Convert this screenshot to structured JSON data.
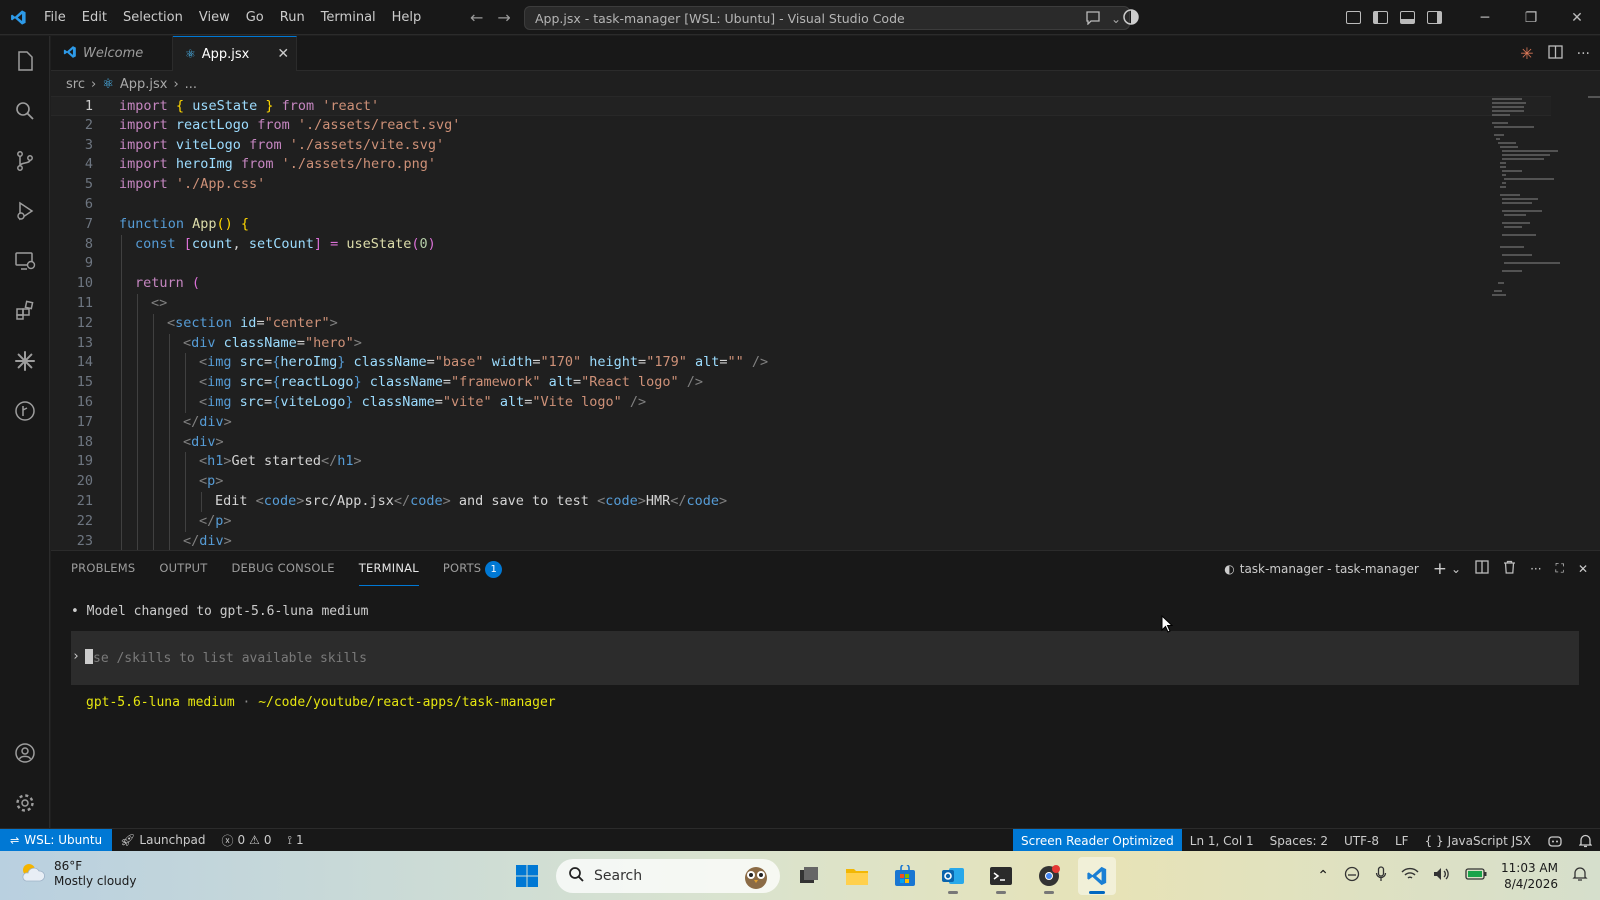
{
  "window": {
    "title": "App.jsx - task-manager [WSL: Ubuntu] - Visual Studio Code",
    "menu": [
      "File",
      "Edit",
      "Selection",
      "View",
      "Go",
      "Run",
      "Terminal",
      "Help"
    ]
  },
  "tabs": [
    {
      "label": "Welcome",
      "icon": "vscode-icon"
    },
    {
      "label": "App.jsx",
      "icon": "react-icon"
    }
  ],
  "breadcrumb": {
    "folder": "src",
    "file": "App.jsx",
    "more": "..."
  },
  "editor": {
    "current_line": 1,
    "lines": [
      "1",
      "2",
      "3",
      "4",
      "5",
      "6",
      "7",
      "8",
      "9",
      "10",
      "11",
      "12",
      "13",
      "14",
      "15",
      "16",
      "17",
      "18",
      "19",
      "20",
      "21",
      "22",
      "23"
    ],
    "code": {
      "l1": [
        "import",
        "{ ",
        "useState",
        " } ",
        "from",
        " 'react'"
      ],
      "l2": [
        "import",
        " reactLogo ",
        "from",
        " './assets/react.svg'"
      ],
      "l3": [
        "import",
        " viteLogo ",
        "from",
        " './assets/vite.svg'"
      ],
      "l4": [
        "import",
        " heroImg ",
        "from",
        " './assets/hero.png'"
      ],
      "l5": [
        "import",
        " './App.css'"
      ],
      "l7": [
        "function",
        " App",
        "() {"
      ],
      "l8": [
        "const",
        " [",
        "count",
        ", ",
        "setCount",
        "] = ",
        "useState",
        "(",
        "0",
        ")"
      ],
      "l10": [
        "return",
        " ("
      ],
      "l11": [
        "<>"
      ],
      "l12": [
        "<",
        "section",
        " id",
        "=",
        "\"center\"",
        ">"
      ],
      "l13": [
        "<",
        "div",
        " className",
        "=",
        "\"hero\"",
        ">"
      ],
      "l14": [
        "<",
        "img",
        " src",
        "=",
        "{",
        "heroImg",
        "}",
        " className",
        "=",
        "\"base\"",
        " width",
        "=",
        "\"170\"",
        " height",
        "=",
        "\"179\"",
        " alt",
        "=",
        "\"\"",
        " />"
      ],
      "l15": [
        "<",
        "img",
        " src",
        "=",
        "{",
        "reactLogo",
        "}",
        " className",
        "=",
        "\"framework\"",
        " alt",
        "=",
        "\"React logo\"",
        " />"
      ],
      "l16": [
        "<",
        "img",
        " src",
        "=",
        "{",
        "viteLogo",
        "}",
        " className",
        "=",
        "\"vite\"",
        " alt",
        "=",
        "\"Vite logo\"",
        " />"
      ],
      "l17": [
        "</",
        "div",
        ">"
      ],
      "l18": [
        "<",
        "div",
        ">"
      ],
      "l19": [
        "<",
        "h1",
        ">",
        "Get started",
        "</",
        "h1",
        ">"
      ],
      "l20": [
        "<",
        "p",
        ">"
      ],
      "l21": [
        "Edit ",
        "<",
        "code",
        ">",
        "src/App.jsx",
        "</",
        "code",
        ">",
        " and save to test ",
        "<",
        "code",
        ">",
        "HMR",
        "</",
        "code",
        ">"
      ],
      "l22": [
        "</",
        "p",
        ">"
      ],
      "l23": [
        "</",
        "div",
        ">"
      ]
    }
  },
  "panel": {
    "tabs": [
      "PROBLEMS",
      "OUTPUT",
      "DEBUG CONSOLE",
      "TERMINAL",
      "PORTS"
    ],
    "ports_badge": "1",
    "terminal_name": "task-manager - task-manager",
    "line1": "• Model changed to gpt-5.6-luna medium",
    "prompt_marker": "›",
    "input_placeholder": "se /skills to list available skills",
    "status_model": "gpt-5.6-luna medium",
    "status_sep": " · ",
    "status_path": "~/code/youtube/react-apps/task-manager"
  },
  "statusbar": {
    "remote": "WSL: Ubuntu",
    "launchpad": "Launchpad",
    "errors": "0",
    "warnings": "0",
    "ports": "1",
    "screen_reader": "Screen Reader Optimized",
    "position": "Ln 1, Col 1",
    "spaces": "Spaces: 2",
    "encoding": "UTF-8",
    "eol": "LF",
    "language": "JavaScript JSX"
  },
  "taskbar": {
    "temp": "86°F",
    "weather": "Mostly cloudy",
    "search": "Search",
    "time": "11:03 AM",
    "date": "8/4/2026"
  }
}
